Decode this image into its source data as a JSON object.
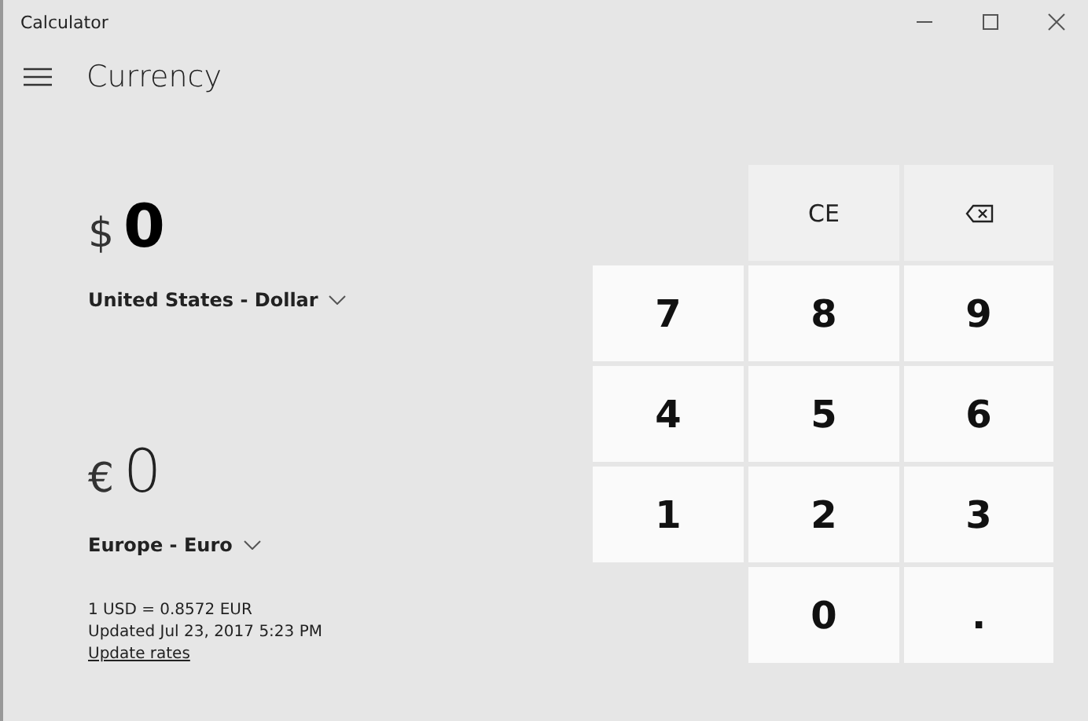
{
  "window": {
    "title": "Calculator"
  },
  "header": {
    "title": "Currency"
  },
  "from": {
    "symbol": "$",
    "value": "0",
    "currency": "United States - Dollar",
    "active": true
  },
  "to": {
    "symbol": "€",
    "value": "0",
    "currency": "Europe - Euro",
    "active": false
  },
  "rate": "1 USD = 0.8572 EUR",
  "updated": "Updated Jul 23, 2017 5:23 PM",
  "update_link": "Update rates",
  "keypad": [
    {
      "kind": "empty"
    },
    {
      "kind": "function",
      "label": "CE"
    },
    {
      "kind": "backspace"
    },
    {
      "kind": "digit",
      "label": "7"
    },
    {
      "kind": "digit",
      "label": "8"
    },
    {
      "kind": "digit",
      "label": "9"
    },
    {
      "kind": "digit",
      "label": "4"
    },
    {
      "kind": "digit",
      "label": "5"
    },
    {
      "kind": "digit",
      "label": "6"
    },
    {
      "kind": "digit",
      "label": "1"
    },
    {
      "kind": "digit",
      "label": "2"
    },
    {
      "kind": "digit",
      "label": "3"
    },
    {
      "kind": "empty"
    },
    {
      "kind": "digit",
      "label": "0"
    },
    {
      "kind": "digit",
      "label": "."
    }
  ]
}
